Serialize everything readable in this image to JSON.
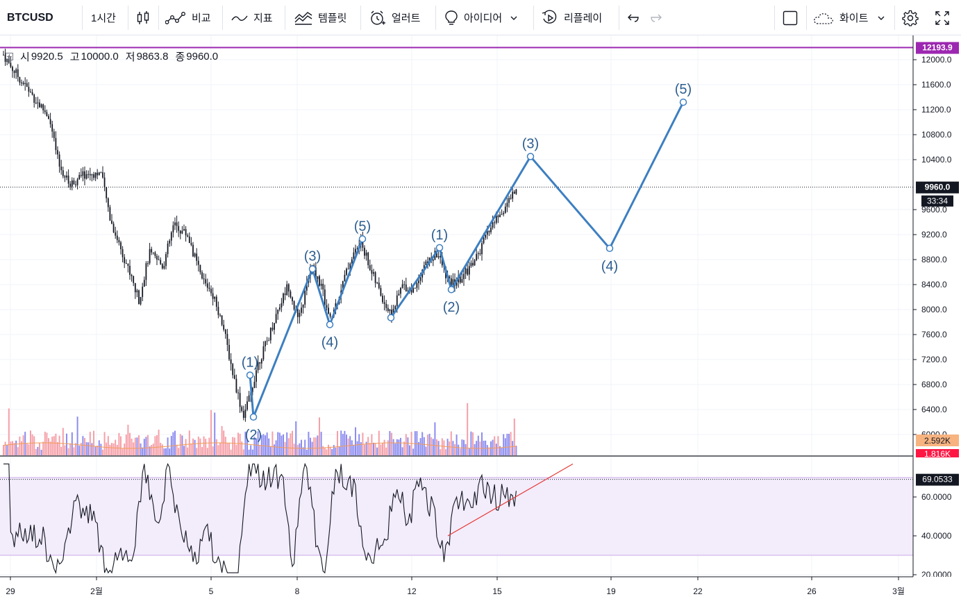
{
  "toolbar": {
    "symbol": "BTCUSD",
    "interval": "1시간",
    "compare": "비교",
    "indicators": "지표",
    "templates": "템플릿",
    "alert": "얼러트",
    "ideas": "아이디어",
    "replay": "리플레이",
    "theme": "화이트"
  },
  "legend": {
    "open_label": "시",
    "open": "9920.5",
    "high_label": "고",
    "high": "10000.0",
    "low_label": "저",
    "low": "9863.8",
    "close_label": "종",
    "close": "9960.0"
  },
  "price_axis": {
    "ticks": [
      "12000.0",
      "11600.0",
      "11200.0",
      "10800.0",
      "10400.0",
      "9600.0",
      "9200.0",
      "8800.0",
      "8400.0",
      "8000.0",
      "7600.0",
      "7200.0",
      "6800.0",
      "6400.0",
      "6000.0"
    ],
    "tick_values": [
      12000,
      11600,
      11200,
      10800,
      10400,
      9600,
      9200,
      8800,
      8400,
      8000,
      7600,
      7200,
      6800,
      6400,
      6000
    ],
    "high_line_label": "12193.9",
    "high_line_value": 12193.9,
    "current_price_label": "9960.0",
    "current_price_value": 9960,
    "countdown": "33:34",
    "volume_label_1": "2.592K",
    "volume_label_2": "1.816K"
  },
  "rsi_axis": {
    "ticks": [
      "60.0000",
      "40.0000",
      "20.0000"
    ],
    "tick_values": [
      60,
      40,
      20
    ],
    "current_label": "69.0533",
    "current_value": 69.0533,
    "band_upper": 70,
    "band_lower": 30
  },
  "time_axis": {
    "labels": [
      "29",
      "2월",
      "5",
      "8",
      "12",
      "15",
      "19",
      "22",
      "26",
      "3월"
    ]
  },
  "chart_data": {
    "type": "line",
    "title": "BTCUSD",
    "price_range": [
      5850,
      12250
    ],
    "rsi_range": [
      18,
      80
    ],
    "elliott_waves": [
      {
        "label": "(1)",
        "price": 6950
      },
      {
        "label": "(2)",
        "price": 6280
      },
      {
        "label": "(3)",
        "price": 8650
      },
      {
        "label": "(4)",
        "price": 7760
      },
      {
        "label": "(5)",
        "price": 9130
      },
      {
        "label": "(1)",
        "price": 8990
      },
      {
        "label": "(2)",
        "price": 8320
      },
      {
        "label": "(3)",
        "price": 10450
      },
      {
        "label": "(4)",
        "price": 8980
      },
      {
        "label": "(5)",
        "price": 11320
      }
    ],
    "rsi_trendline": {
      "from": 40,
      "to": 77
    },
    "colors": {
      "wave": "#3d7fc1",
      "candle": "#131722",
      "volume_up": "#8c8cf0",
      "volume_down": "#f5a0a8",
      "rsi_line": "#131722",
      "rsi_band": "#f3ecfb",
      "high_line": "#9c27b0",
      "trendline": "#e53935"
    }
  }
}
